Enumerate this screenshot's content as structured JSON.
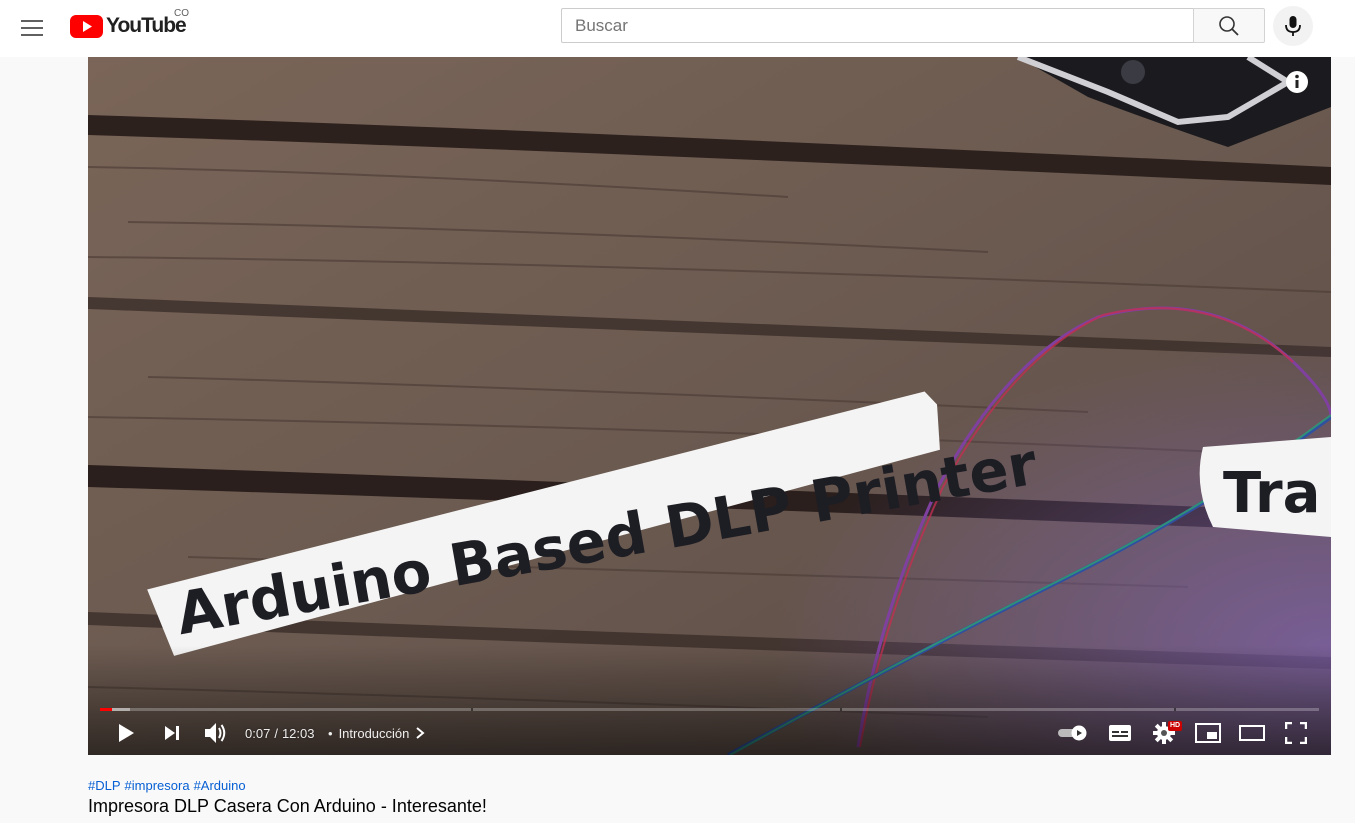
{
  "header": {
    "logo_text": "YouTube",
    "country_code": "CO",
    "search": {
      "placeholder": "Buscar",
      "value": ""
    }
  },
  "player": {
    "video_text": {
      "sign_main": "Arduino Based DLP Printer",
      "sign_partial": "Tra"
    },
    "time": {
      "current": "0:07",
      "separator": "/",
      "duration": "12:03"
    },
    "chapter": {
      "bullet": "•",
      "label": "Introducción"
    },
    "progress": {
      "played_fraction": 0.01,
      "loaded_fraction": 0.025
    },
    "hd_badge": "HD"
  },
  "video": {
    "hashtags": [
      "#DLP",
      "#impresora",
      "#Arduino"
    ],
    "title": "Impresora DLP Casera Con Arduino - Interesante!"
  },
  "colors": {
    "brand_red": "#ff0000",
    "hashtag_blue": "#065fd4",
    "title_text": "#030303"
  }
}
